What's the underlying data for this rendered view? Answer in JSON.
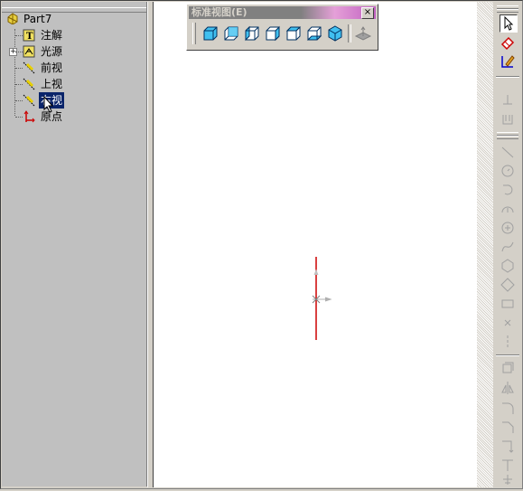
{
  "tree": {
    "root": {
      "label": "Part7",
      "icon": "part-icon"
    },
    "items": [
      {
        "label": "注解",
        "icon": "annotation-icon",
        "expandable": false
      },
      {
        "label": "光源",
        "icon": "lighting-icon",
        "expandable": true
      },
      {
        "label": "前视",
        "icon": "plane-icon",
        "expandable": false
      },
      {
        "label": "上视",
        "icon": "plane-icon",
        "expandable": false
      },
      {
        "label": "右视",
        "icon": "plane-icon",
        "expandable": false,
        "selected": true
      },
      {
        "label": "原点",
        "icon": "origin-icon",
        "expandable": false
      }
    ]
  },
  "standard_views_toolbar": {
    "title": "标准视图(E)",
    "close_label": "×",
    "buttons": [
      "front-view-icon",
      "back-view-icon",
      "left-view-icon",
      "right-view-icon",
      "top-view-icon",
      "bottom-view-icon",
      "isometric-view-icon",
      "normal-to-icon"
    ]
  },
  "colors": {
    "selection": "#0a246a",
    "axis_red": "#cc0000",
    "toolbar_bg": "#d4d0c8"
  },
  "right_toolbar": {
    "icons": [
      "select-icon",
      "eraser-icon",
      "sketch-icon",
      "dimension-icon",
      "relation-icon",
      "line-icon",
      "circle-icon",
      "tangent-arc-icon",
      "centerpoint-arc-icon",
      "point-circle-icon",
      "spline-icon",
      "polygon-icon",
      "rectangle-icon",
      "parallelogram-icon",
      "point-icon",
      "centerline-icon",
      "offset-icon",
      "mirror-icon",
      "fillet-icon",
      "chamfer-icon",
      "trim-icon",
      "extend-icon",
      "split-icon"
    ]
  }
}
